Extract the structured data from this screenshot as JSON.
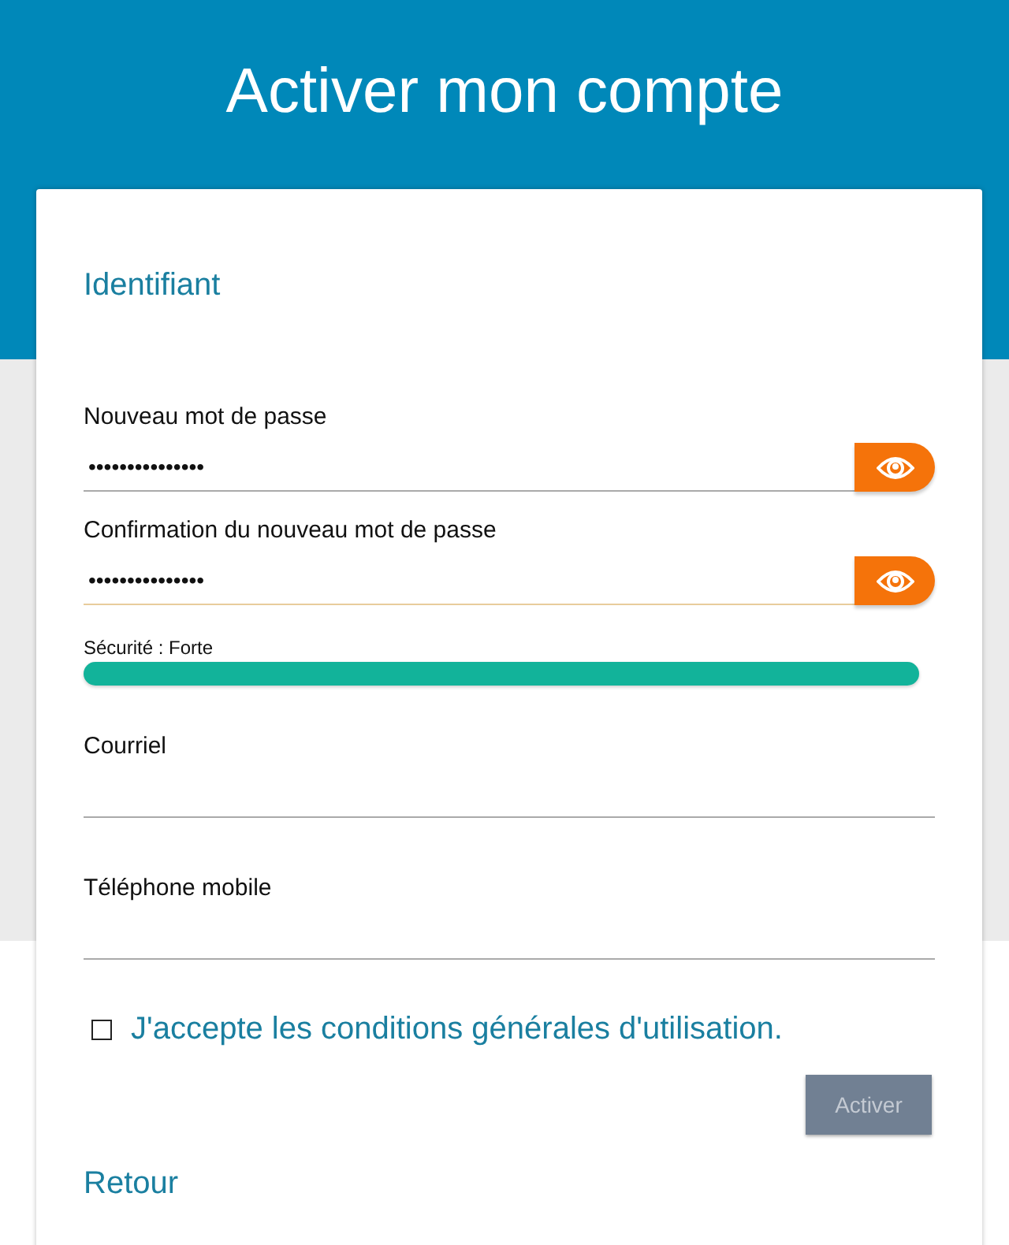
{
  "header": {
    "title": "Activer mon compte"
  },
  "section_title": "Identifiant",
  "password_fields": [
    {
      "label": "Nouveau mot de passe",
      "value": "•••••••••••••••",
      "focused": false
    },
    {
      "label": "Confirmation du nouveau mot de passe",
      "value": "•••••••••••••••",
      "focused": true
    }
  ],
  "strength": {
    "label": "Sécurité : Forte",
    "level": 1.0
  },
  "text_fields": [
    {
      "label": "Courriel"
    },
    {
      "label": "Téléphone mobile"
    }
  ],
  "terms": {
    "label": "J'accepte les conditions générales d'utilisation.",
    "checked": false
  },
  "submit": {
    "label": "Activer",
    "disabled": true
  },
  "back_link": "Retour"
}
